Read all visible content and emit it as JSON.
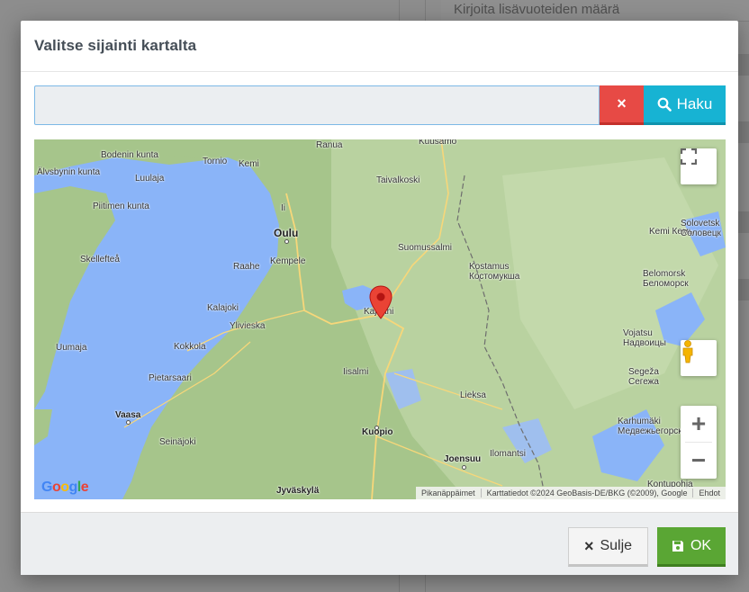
{
  "background": {
    "field_text": "Kirjoita lisävuoteiden määrä"
  },
  "modal": {
    "title": "Valitse sijainti kartalta",
    "search": {
      "value": "",
      "placeholder": "",
      "clear_label": "×",
      "search_label": "Haku"
    },
    "map": {
      "icons": {
        "fullscreen": "fullscreen-icon",
        "pegman": "street-view-pegman-icon",
        "zoom_in": "plus-icon",
        "zoom_out": "minus-icon",
        "marker": "map-marker-icon"
      },
      "zoom_in_label": "+",
      "zoom_out_label": "−",
      "google_logo": "Google",
      "attribution": {
        "shortcuts": "Pikanäppäimet",
        "data": "Karttatiedot ©2024 GeoBasis-DE/BKG (©2009), Google",
        "terms": "Ehdot"
      },
      "places": [
        {
          "name": "Ranua"
        },
        {
          "name": "Kuusamo"
        },
        {
          "name": "Bodenin kunta"
        },
        {
          "name": "Tornio"
        },
        {
          "name": "Kemi"
        },
        {
          "name": "Älvsbynin kunta"
        },
        {
          "name": "Luulaja"
        },
        {
          "name": "Taivalkoski"
        },
        {
          "name": "Piitimen kunta"
        },
        {
          "name": "Ii"
        },
        {
          "name": "Oulu"
        },
        {
          "name": "Kemi Кемь"
        },
        {
          "name": "Solovetsk Соловецк"
        },
        {
          "name": "Suomussalmi"
        },
        {
          "name": "Skellefteå"
        },
        {
          "name": "Raahe"
        },
        {
          "name": "Kempele"
        },
        {
          "name": "Kostamus Костомукша"
        },
        {
          "name": "Belomorsk Беломорск"
        },
        {
          "name": "Kajaani"
        },
        {
          "name": "Kalajoki"
        },
        {
          "name": "Ylivieska"
        },
        {
          "name": "Vojatsu Надвоицы"
        },
        {
          "name": "Uumaja"
        },
        {
          "name": "Kokkola"
        },
        {
          "name": "Pietarsaari"
        },
        {
          "name": "Iisalmi"
        },
        {
          "name": "Segeža Сегежа"
        },
        {
          "name": "Lieksa"
        },
        {
          "name": "Vaasa"
        },
        {
          "name": "Kuopio"
        },
        {
          "name": "Karhumäki Медвежьегорск"
        },
        {
          "name": "Seinäjoki"
        },
        {
          "name": "Ilomantsi"
        },
        {
          "name": "Joensuu"
        },
        {
          "name": "Jyväskylä"
        },
        {
          "name": "Kontupohja"
        }
      ]
    },
    "footer": {
      "close_label": "Sulje",
      "ok_label": "OK"
    }
  },
  "colors": {
    "clear_button": "#e74a45",
    "search_button": "#17b3d3",
    "ok_button": "#5aa634",
    "map_water": "#8ab4f8",
    "map_land": "#a6c58b"
  }
}
